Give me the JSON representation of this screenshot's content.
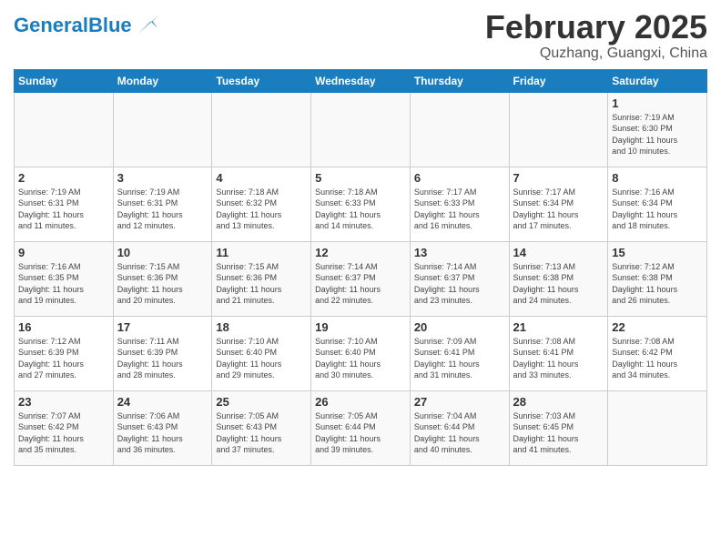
{
  "header": {
    "logo_general": "General",
    "logo_blue": "Blue",
    "title": "February 2025",
    "location": "Quzhang, Guangxi, China"
  },
  "days_of_week": [
    "Sunday",
    "Monday",
    "Tuesday",
    "Wednesday",
    "Thursday",
    "Friday",
    "Saturday"
  ],
  "weeks": [
    [
      {
        "day": "",
        "info": ""
      },
      {
        "day": "",
        "info": ""
      },
      {
        "day": "",
        "info": ""
      },
      {
        "day": "",
        "info": ""
      },
      {
        "day": "",
        "info": ""
      },
      {
        "day": "",
        "info": ""
      },
      {
        "day": "1",
        "info": "Sunrise: 7:19 AM\nSunset: 6:30 PM\nDaylight: 11 hours\nand 10 minutes."
      }
    ],
    [
      {
        "day": "2",
        "info": "Sunrise: 7:19 AM\nSunset: 6:31 PM\nDaylight: 11 hours\nand 11 minutes."
      },
      {
        "day": "3",
        "info": "Sunrise: 7:19 AM\nSunset: 6:31 PM\nDaylight: 11 hours\nand 12 minutes."
      },
      {
        "day": "4",
        "info": "Sunrise: 7:18 AM\nSunset: 6:32 PM\nDaylight: 11 hours\nand 13 minutes."
      },
      {
        "day": "5",
        "info": "Sunrise: 7:18 AM\nSunset: 6:33 PM\nDaylight: 11 hours\nand 14 minutes."
      },
      {
        "day": "6",
        "info": "Sunrise: 7:17 AM\nSunset: 6:33 PM\nDaylight: 11 hours\nand 16 minutes."
      },
      {
        "day": "7",
        "info": "Sunrise: 7:17 AM\nSunset: 6:34 PM\nDaylight: 11 hours\nand 17 minutes."
      },
      {
        "day": "8",
        "info": "Sunrise: 7:16 AM\nSunset: 6:34 PM\nDaylight: 11 hours\nand 18 minutes."
      }
    ],
    [
      {
        "day": "9",
        "info": "Sunrise: 7:16 AM\nSunset: 6:35 PM\nDaylight: 11 hours\nand 19 minutes."
      },
      {
        "day": "10",
        "info": "Sunrise: 7:15 AM\nSunset: 6:36 PM\nDaylight: 11 hours\nand 20 minutes."
      },
      {
        "day": "11",
        "info": "Sunrise: 7:15 AM\nSunset: 6:36 PM\nDaylight: 11 hours\nand 21 minutes."
      },
      {
        "day": "12",
        "info": "Sunrise: 7:14 AM\nSunset: 6:37 PM\nDaylight: 11 hours\nand 22 minutes."
      },
      {
        "day": "13",
        "info": "Sunrise: 7:14 AM\nSunset: 6:37 PM\nDaylight: 11 hours\nand 23 minutes."
      },
      {
        "day": "14",
        "info": "Sunrise: 7:13 AM\nSunset: 6:38 PM\nDaylight: 11 hours\nand 24 minutes."
      },
      {
        "day": "15",
        "info": "Sunrise: 7:12 AM\nSunset: 6:38 PM\nDaylight: 11 hours\nand 26 minutes."
      }
    ],
    [
      {
        "day": "16",
        "info": "Sunrise: 7:12 AM\nSunset: 6:39 PM\nDaylight: 11 hours\nand 27 minutes."
      },
      {
        "day": "17",
        "info": "Sunrise: 7:11 AM\nSunset: 6:39 PM\nDaylight: 11 hours\nand 28 minutes."
      },
      {
        "day": "18",
        "info": "Sunrise: 7:10 AM\nSunset: 6:40 PM\nDaylight: 11 hours\nand 29 minutes."
      },
      {
        "day": "19",
        "info": "Sunrise: 7:10 AM\nSunset: 6:40 PM\nDaylight: 11 hours\nand 30 minutes."
      },
      {
        "day": "20",
        "info": "Sunrise: 7:09 AM\nSunset: 6:41 PM\nDaylight: 11 hours\nand 31 minutes."
      },
      {
        "day": "21",
        "info": "Sunrise: 7:08 AM\nSunset: 6:41 PM\nDaylight: 11 hours\nand 33 minutes."
      },
      {
        "day": "22",
        "info": "Sunrise: 7:08 AM\nSunset: 6:42 PM\nDaylight: 11 hours\nand 34 minutes."
      }
    ],
    [
      {
        "day": "23",
        "info": "Sunrise: 7:07 AM\nSunset: 6:42 PM\nDaylight: 11 hours\nand 35 minutes."
      },
      {
        "day": "24",
        "info": "Sunrise: 7:06 AM\nSunset: 6:43 PM\nDaylight: 11 hours\nand 36 minutes."
      },
      {
        "day": "25",
        "info": "Sunrise: 7:05 AM\nSunset: 6:43 PM\nDaylight: 11 hours\nand 37 minutes."
      },
      {
        "day": "26",
        "info": "Sunrise: 7:05 AM\nSunset: 6:44 PM\nDaylight: 11 hours\nand 39 minutes."
      },
      {
        "day": "27",
        "info": "Sunrise: 7:04 AM\nSunset: 6:44 PM\nDaylight: 11 hours\nand 40 minutes."
      },
      {
        "day": "28",
        "info": "Sunrise: 7:03 AM\nSunset: 6:45 PM\nDaylight: 11 hours\nand 41 minutes."
      },
      {
        "day": "",
        "info": ""
      }
    ]
  ]
}
